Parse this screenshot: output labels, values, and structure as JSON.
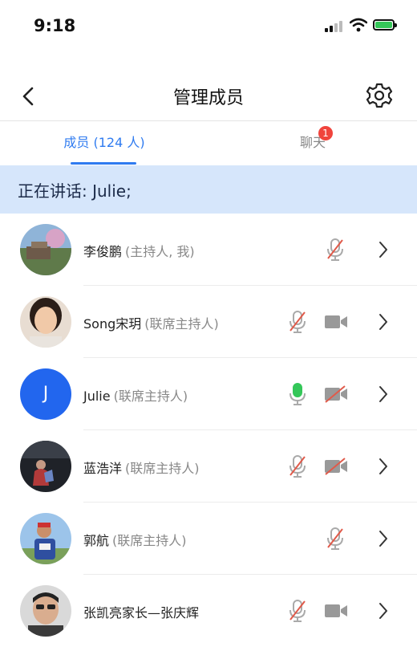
{
  "status_bar": {
    "time": "9:18"
  },
  "header": {
    "title": "管理成员"
  },
  "tabs": [
    {
      "label": "成员 (124 人)",
      "active": true
    },
    {
      "label": "聊天",
      "badge": "1"
    }
  ],
  "speaking": {
    "text": "正在讲话: Julie;"
  },
  "members": [
    {
      "name": "李俊鹏",
      "role": "(主持人, 我)",
      "mic": "muted",
      "camera": "none"
    },
    {
      "name": "Song宋玥",
      "role": "(联席主持人)",
      "mic": "muted",
      "camera": "on"
    },
    {
      "name": "Julie",
      "role": "(联席主持人)",
      "mic": "active",
      "camera": "off",
      "avatar_letter": "J"
    },
    {
      "name": "蓝浩洋",
      "role": "(联席主持人)",
      "mic": "muted",
      "camera": "off"
    },
    {
      "name": "郭航",
      "role": "(联席主持人)",
      "mic": "muted",
      "camera": "none"
    },
    {
      "name": "张凯亮家长—张庆辉",
      "role": "",
      "mic": "muted",
      "camera": "on"
    }
  ],
  "colors": {
    "accent": "#2f7bf0",
    "speaking_bg": "#d6e6fb",
    "badge": "#f0443c",
    "mic_active": "#34c759",
    "muted_slash": "#e05a4a"
  }
}
